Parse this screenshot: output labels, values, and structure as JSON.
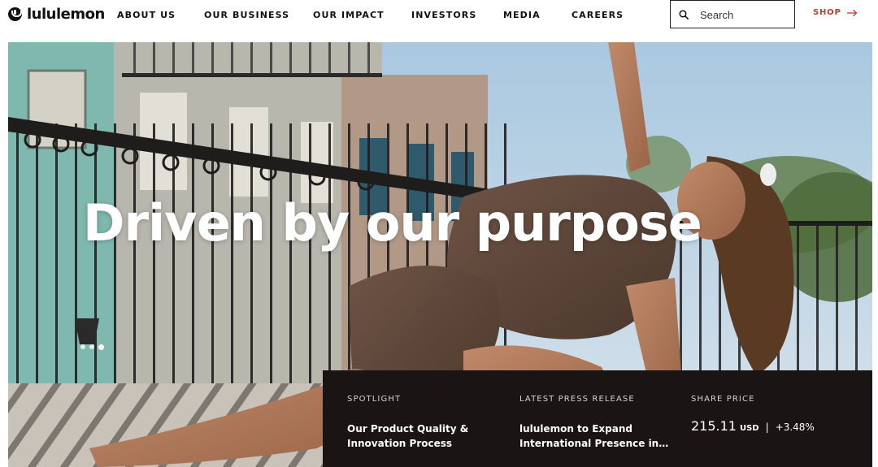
{
  "brand": {
    "name": "lululemon"
  },
  "nav": {
    "items": [
      {
        "label": "ABOUT US"
      },
      {
        "label": "OUR BUSINESS"
      },
      {
        "label": "OUR IMPACT"
      },
      {
        "label": "INVESTORS"
      },
      {
        "label": "MEDIA"
      },
      {
        "label": "CAREERS"
      }
    ]
  },
  "search": {
    "placeholder": "Search",
    "icon": "search-icon"
  },
  "shop": {
    "label": "SHOP",
    "icon": "arrow-right-icon",
    "color": "#c0392b"
  },
  "hero": {
    "title": "Driven by our purpose",
    "carousel": {
      "slides": 3,
      "active_index": 2
    }
  },
  "panel": {
    "background": "#1a1514",
    "spotlight": {
      "label": "SPOTLIGHT",
      "line1": "Our Product Quality &",
      "line2": "Innovation Process"
    },
    "press": {
      "label": "LATEST PRESS RELEASE",
      "line1": "lululemon to Expand",
      "line2": "International Presence in…"
    },
    "share": {
      "label": "SHARE PRICE",
      "value": "215.11",
      "currency": "USD",
      "separator": "|",
      "change": "+3.48%"
    }
  }
}
